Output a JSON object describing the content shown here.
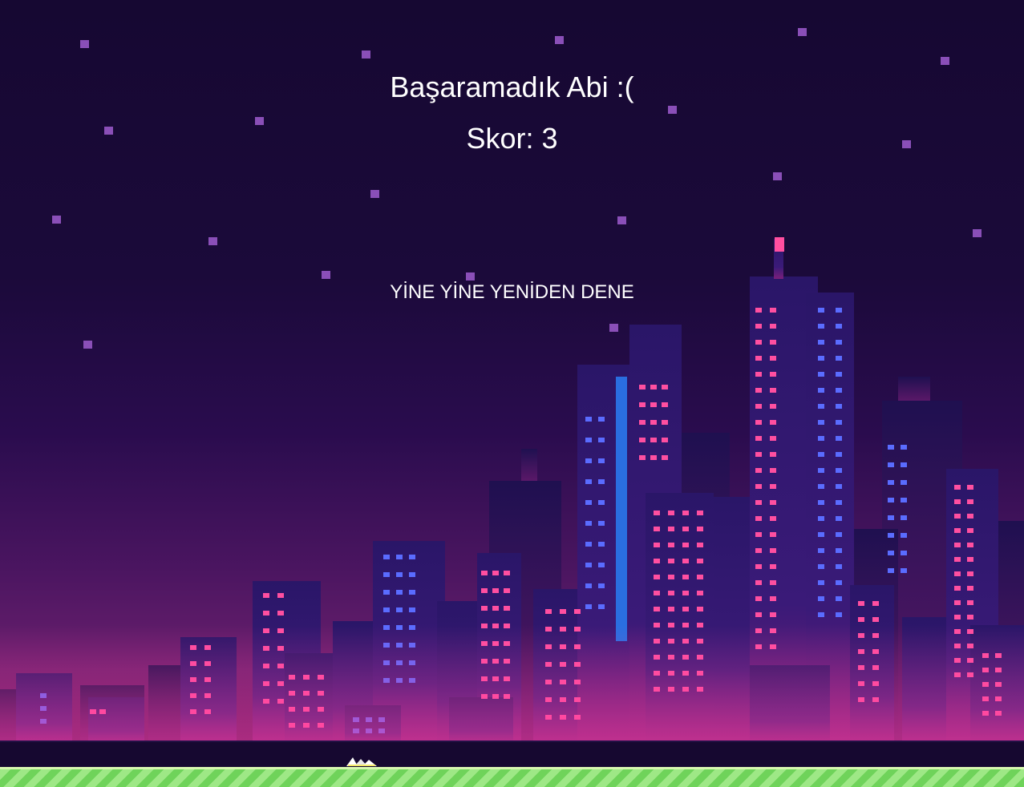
{
  "game_over": {
    "title": "Başaramadık Abi :(",
    "score_label": "Skor:",
    "score_value": "3",
    "retry_label": "YİNE YİNE YENİDEN DENE"
  },
  "colors": {
    "sky_top": "#160832",
    "sky_bottom": "#6a1f6e",
    "star": "#8a4fb8",
    "building_dark": "#1e0f4a",
    "building_mid": "#2e1b6b",
    "window_pink": "#ff4fa0",
    "window_blue": "#5a6cff",
    "grass": "#6fd35a",
    "text": "#ffffff"
  },
  "icons": {
    "player": "pixel-character-icon"
  }
}
